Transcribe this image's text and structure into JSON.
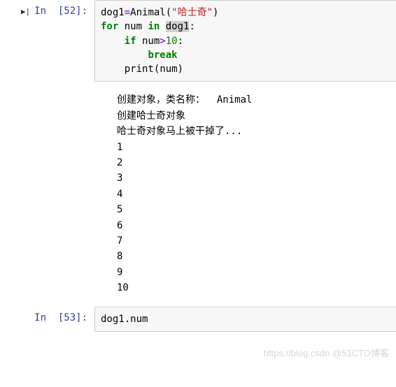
{
  "cells": [
    {
      "prompt": "In  [52]:",
      "code": {
        "var1": "dog1",
        "eq": "=",
        "fn": "Animal",
        "open": "(",
        "str": "\"哈士奇\"",
        "close": ")",
        "kw_for": "for",
        "var_num": " num ",
        "kw_in": "in",
        "space": " ",
        "var1b": "dog1",
        "colon1": ":",
        "indent1": "    ",
        "kw_if": "if",
        "var_num2": " num",
        "gt": ">",
        "lit10": "10",
        "colon2": ":",
        "indent2": "        ",
        "kw_break": "break",
        "indent3": "    ",
        "fn_print": "print",
        "open2": "(",
        "var_num3": "num",
        "close2": ")"
      },
      "output": "创建对象，类名称：  Animal\n创建哈士奇对象\n哈士奇对象马上被干掉了...\n1\n2\n3\n4\n5\n6\n7\n8\n9\n10"
    },
    {
      "prompt": "In  [53]:",
      "code_text": "dog1.num"
    }
  ],
  "watermark": "https://blog.csdn.@51CTO博客"
}
